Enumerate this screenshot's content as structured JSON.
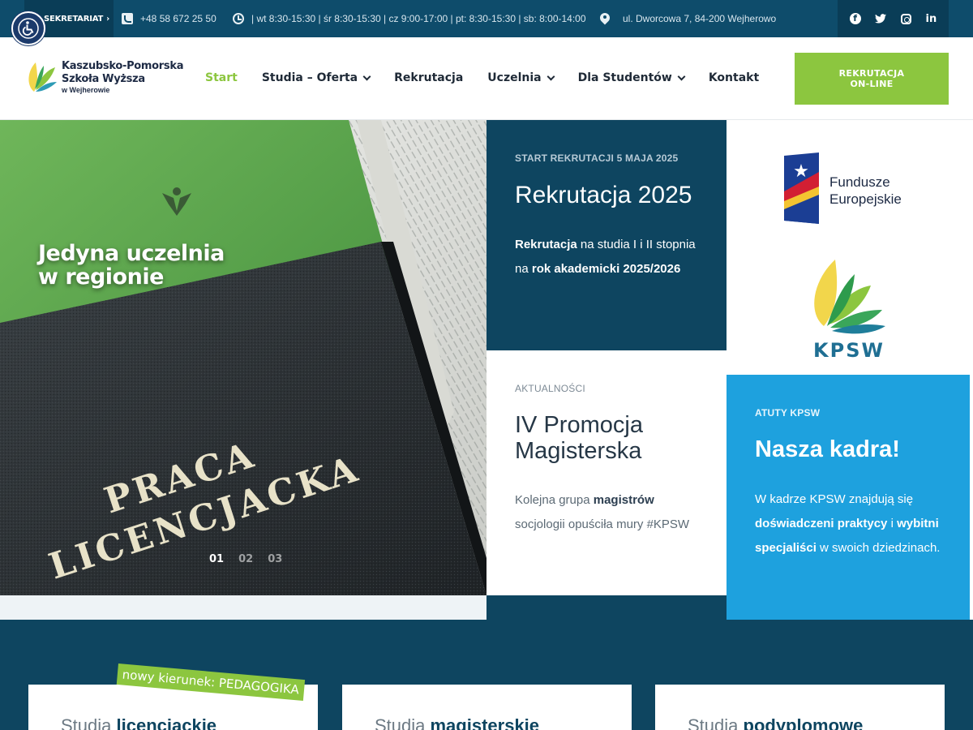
{
  "topbar": {
    "secretariat_label": "SEKRETARIAT",
    "phone": "+48 58 672 25 50",
    "hours": "| wt 8:30-15:30 | śr 8:30-15:30 | cz 9:00-17:00 | pt: 8:30-15:30 | sb: 8:00-14:00",
    "address": "ul. Dworcowa 7, 84-200 Wejherowo",
    "socials": [
      "facebook-icon",
      "twitter-icon",
      "instagram-icon",
      "linkedin-icon"
    ]
  },
  "header": {
    "logo_line1": "Kaszubsko-Pomorska",
    "logo_line2": "Szkoła Wyższa",
    "logo_line3": "w Wejherowie",
    "nav": [
      {
        "label": "Start"
      },
      {
        "label": "Studia – Oferta"
      },
      {
        "label": "Rekrutacja"
      },
      {
        "label": "Uczelnia"
      },
      {
        "label": "Dla Studentów"
      },
      {
        "label": "Kontakt"
      }
    ],
    "cta_line1": "REKRUTACJA",
    "cta_line2": "ON-LINE"
  },
  "hero": {
    "caption_line1": "Jedyna uczelnia",
    "caption_line2": "w regionie",
    "book_text_line1": "PRACA",
    "book_text_line2": "LICENCJACKA",
    "dots": [
      "01",
      "02",
      "03"
    ]
  },
  "cards": {
    "recruitment": {
      "kicker": "START REKRUTACJI 5 MAJA 2025",
      "title": "Rekrutacja 2025",
      "b1": "Rekrutacja",
      "t1": " na studia I i II stopnia na ",
      "b2": "rok akademicki 2025/2026"
    },
    "news": {
      "kicker": "AKTUALNOŚCI",
      "title": "IV Promocja Magisterska",
      "t1": "Kolejna grupa ",
      "b1": "magistrów",
      "t2": " socjologii opuściła mury #KPSW"
    },
    "staff": {
      "kicker": "ATUTY KPSW",
      "title": "Nasza kadra!",
      "t1": "W kadrze KPSW znajdują się ",
      "b1": "doświadczeni praktycy",
      "t2": " i ",
      "b2": "wybitni specjaliści",
      "t3": " w swoich dziedzinach."
    }
  },
  "funds": {
    "line1": "Fundusze",
    "line2": "Europejskie",
    "kpsw_label": "KPSW"
  },
  "studies": {
    "badge": "nowy kierunek: PEDAGOGIKA",
    "items": [
      {
        "prefix": "Studia ",
        "bold": "licencjackie"
      },
      {
        "prefix": "Studia ",
        "bold": "magisterskie"
      },
      {
        "prefix": "Studia ",
        "bold": "podyplomowe"
      }
    ]
  },
  "colors": {
    "navy": "#0e4560",
    "green": "#8cc63f",
    "blue": "#1ea1de"
  }
}
